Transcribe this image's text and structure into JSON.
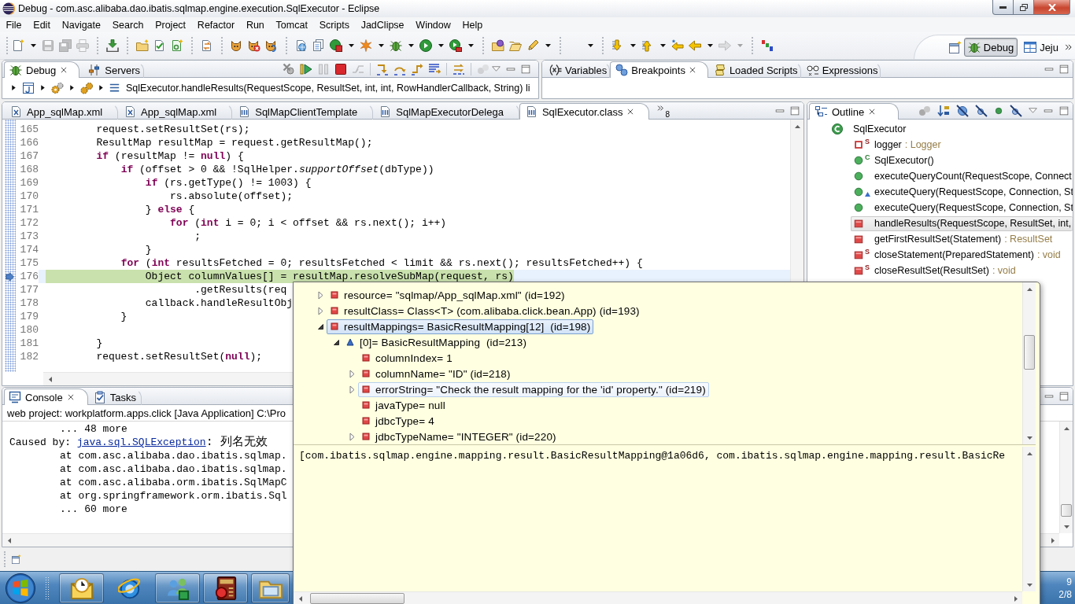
{
  "window": {
    "title": "Debug - com.asc.alibaba.dao.ibatis.sqlmap.engine.execution.SqlExecutor - Eclipse"
  },
  "menu": [
    "File",
    "Edit",
    "Navigate",
    "Search",
    "Project",
    "Refactor",
    "Run",
    "Tomcat",
    "Scripts",
    "JadClipse",
    "Window",
    "Help"
  ],
  "toolbar": [
    [
      {
        "disabled": false,
        "dropdown": true
      },
      {
        "disabled": true,
        "dropdown": false
      },
      {
        "disabled": true,
        "dropdown": false
      },
      {
        "disabled": true,
        "dropdown": false
      }
    ],
    [
      {
        "disabled": false,
        "dropdown": false
      }
    ],
    [
      {
        "disabled": false,
        "dropdown": false
      },
      {
        "disabled": false,
        "dropdown": false
      },
      {
        "disabled": false,
        "dropdown": false
      }
    ],
    [
      {
        "disabled": false,
        "dropdown": false
      }
    ],
    [
      {
        "disabled": false,
        "dropdown": false
      },
      {
        "disabled": false,
        "dropdown": false
      },
      {
        "disabled": false,
        "dropdown": false
      }
    ],
    [
      {
        "disabled": false,
        "dropdown": false
      },
      {
        "disabled": false,
        "dropdown": false
      },
      {
        "disabled": false,
        "dropdown": true
      },
      {
        "disabled": false,
        "dropdown": true
      },
      {
        "disabled": false,
        "dropdown": true
      },
      {
        "disabled": false,
        "dropdown": true
      },
      {
        "disabled": false,
        "dropdown": true
      }
    ],
    [
      {
        "disabled": false,
        "dropdown": false
      },
      {
        "disabled": false,
        "dropdown": false
      },
      {
        "disabled": false,
        "dropdown": true
      }
    ],
    [
      {
        "disabled": false,
        "dropdown": true
      }
    ],
    [
      {
        "disabled": false,
        "dropdown": true
      },
      {
        "disabled": false,
        "dropdown": true
      },
      {
        "disabled": false,
        "dropdown": false
      },
      {
        "disabled": false,
        "dropdown": true
      },
      {
        "disabled": true,
        "dropdown": true
      }
    ],
    [
      {
        "disabled": false,
        "dropdown": false
      }
    ]
  ],
  "perspectives": [
    {
      "label": "Debug",
      "selected": true
    },
    {
      "label": "Jeju",
      "selected": false
    }
  ],
  "debug_view": {
    "tabs": [
      {
        "label": "Debug",
        "selected": true
      },
      {
        "label": "Servers",
        "selected": false
      }
    ],
    "toolbar": [
      [
        {
          "disabled": false
        },
        {
          "disabled": false
        },
        {
          "disabled": true
        },
        {
          "disabled": false
        },
        {
          "disabled": true
        }
      ],
      [
        {
          "disabled": false
        },
        {
          "disabled": false
        },
        {
          "disabled": false
        },
        {
          "disabled": false
        }
      ],
      [
        {
          "disabled": false
        }
      ],
      [
        {
          "disabled": true
        }
      ]
    ],
    "breadcrumb": "SqlExecutor.handleResults(RequestScope, ResultSet, int, int, RowHandlerCallback, String) li"
  },
  "variables_view": {
    "tabs": [
      {
        "label": "Variables",
        "selected": false
      },
      {
        "label": "Breakpoints",
        "selected": true
      },
      {
        "label": "Loaded Scripts",
        "selected": false
      },
      {
        "label": "Expressions",
        "selected": false
      }
    ]
  },
  "editor": {
    "tabs": [
      {
        "label": "App_sqlMap.xml",
        "kind": "xml",
        "selected": false
      },
      {
        "label": "App_sqlMap.xml",
        "kind": "xml",
        "selected": false
      },
      {
        "label": "SqlMapClientTemplate",
        "kind": "class",
        "selected": false
      },
      {
        "label": "SqlMapExecutorDelega",
        "kind": "class",
        "selected": false
      },
      {
        "label": "SqlExecutor.class",
        "kind": "class",
        "selected": true
      }
    ],
    "overflow_count": "8",
    "lines": [
      {
        "number": "165",
        "code": "        request.setResultSet(rs);",
        "current": false
      },
      {
        "number": "166",
        "code": "        ResultMap resultMap = request.getResultMap();",
        "current": false
      },
      {
        "number": "167",
        "code": "        **if** (resultMap != **null**) {",
        "current": false
      },
      {
        "number": "168",
        "code": "            **if** (offset > 0 && !SqlHelper.*supportOffset*(dbType))",
        "current": false
      },
      {
        "number": "169",
        "code": "                **if** (rs.getType() != 1003) {",
        "current": false
      },
      {
        "number": "170",
        "code": "                    rs.absolute(offset);",
        "current": false
      },
      {
        "number": "171",
        "code": "                } **else** {",
        "current": false
      },
      {
        "number": "172",
        "code": "                    **for** (**int** i = 0; i < offset && rs.next(); i++)",
        "current": false
      },
      {
        "number": "173",
        "code": "                        ;",
        "current": false
      },
      {
        "number": "174",
        "code": "                }",
        "current": false
      },
      {
        "number": "175",
        "code": "            **for** (**int** resultsFetched = 0; resultsFetched < limit && rs.next(); resultsFetched++) {",
        "current": false
      },
      {
        "number": "176",
        "code": "                Object columnValues[] = resultMap.resolveSubMap(request, rs)",
        "current": true
      },
      {
        "number": "177",
        "code": "                        .getResults(req",
        "current": false
      },
      {
        "number": "178",
        "code": "                callback.handleResultObj",
        "current": false
      },
      {
        "number": "179",
        "code": "            }",
        "current": false
      },
      {
        "number": "180",
        "current": false
      },
      {
        "number": "181",
        "code": "        }",
        "current": false
      },
      {
        "number": "182",
        "code": "        request.setResultSet(**null**);",
        "current": false
      }
    ]
  },
  "outline": {
    "tabs": [
      {
        "label": "Outline",
        "selected": true
      }
    ],
    "tree": [
      {
        "label": "SqlExecutor",
        "kind": "class",
        "overrides": false,
        "selected": false,
        "children": [
          {
            "label": "logger",
            "decoration": ": Logger",
            "kind": "field",
            "private": true,
            "badge": "S",
            "overrides": false,
            "selected": false
          },
          {
            "label": "SqlExecutor()",
            "kind": "method",
            "private": false,
            "badge": "C",
            "overrides": false,
            "selected": false
          },
          {
            "label": "executeQueryCount(RequestScope, Connect",
            "kind": "method",
            "private": false,
            "overrides": false,
            "selected": false
          },
          {
            "label": "executeQuery(RequestScope, Connection, St",
            "kind": "method",
            "private": false,
            "overrides": true,
            "selected": false
          },
          {
            "label": "executeQuery(RequestScope, Connection, St",
            "kind": "method",
            "private": false,
            "overrides": false,
            "selected": false
          },
          {
            "label": "handleResults(RequestScope, ResultSet, int,",
            "kind": "method",
            "private": true,
            "overrides": false,
            "selected": true
          },
          {
            "label": "getFirstResultSet(Statement)",
            "decoration": ": ResultSet",
            "kind": "method",
            "private": true,
            "overrides": false,
            "selected": false
          },
          {
            "label": "closeStatement(PreparedStatement)",
            "decoration": ": void",
            "kind": "method",
            "private": true,
            "badge": "S",
            "overrides": false,
            "selected": false
          },
          {
            "label": "closeResultSet(ResultSet)",
            "decoration": ": void",
            "kind": "method",
            "private": true,
            "badge": "S",
            "overrides": false,
            "selected": false
          }
        ]
      }
    ]
  },
  "console": {
    "tabs": [
      {
        "label": "Console",
        "selected": true
      },
      {
        "label": "Tasks",
        "selected": false
      }
    ],
    "header": "web project: workplatform.apps.click [Java Application] C:\\Pro",
    "lines": [
      {
        "kind": "frame",
        "text": "... 48 more"
      },
      {
        "kind": "cause",
        "text": "Caused by: ",
        "link": "java.sql.SQLException",
        "message": ": 列名无效"
      },
      {
        "kind": "frame",
        "text": "at com.asc.alibaba.dao.ibatis.sqlmap."
      },
      {
        "kind": "frame",
        "text": "at com.asc.alibaba.dao.ibatis.sqlmap."
      },
      {
        "kind": "frame",
        "text": "at com.asc.alibaba.orm.ibatis.SqlMapC"
      },
      {
        "kind": "frame",
        "text": "at org.springframework.orm.ibatis.Sql"
      },
      {
        "kind": "frame",
        "text": "... 60 more"
      }
    ]
  },
  "taskbar": {
    "buttons": [
      {
        "running": true
      },
      {
        "running": false
      },
      {
        "running": true
      },
      {
        "running": true
      },
      {
        "running": true
      }
    ],
    "clock_time": "9",
    "clock_date": "2/8"
  },
  "inspect_popup": {
    "tree": [
      {
        "label": "resource= \"sqlmap/App_sqlMap.xml\" (id=192)",
        "kind": "field",
        "has_children": true,
        "expanded": false,
        "selected": false,
        "hovered": false
      },
      {
        "label": "resultClass= Class<T> (com.alibaba.click.bean.App) (id=193)",
        "kind": "field",
        "has_children": true,
        "expanded": false,
        "selected": false,
        "hovered": false
      },
      {
        "label": "resultMappings= BasicResultMapping[12]  (id=198)",
        "kind": "field",
        "has_children": true,
        "expanded": true,
        "selected": true,
        "hovered": false,
        "children": [
          {
            "label": "[0]= BasicResultMapping  (id=213)",
            "kind": "element",
            "has_children": true,
            "expanded": true,
            "selected": false,
            "hovered": false,
            "children": [
              {
                "label": "columnIndex= 1",
                "kind": "field",
                "has_children": false,
                "expanded": false,
                "selected": false,
                "hovered": false
              },
              {
                "label": "columnName= \"ID\" (id=218)",
                "kind": "field",
                "has_children": true,
                "expanded": false,
                "selected": false,
                "hovered": false
              },
              {
                "label": "errorString= \"Check the result mapping for the 'id' property.\" (id=219)",
                "kind": "field",
                "has_children": true,
                "expanded": false,
                "selected": false,
                "hovered": true
              },
              {
                "label": "javaType= null",
                "kind": "field",
                "has_children": false,
                "expanded": false,
                "selected": false,
                "hovered": false
              },
              {
                "label": "jdbcType= 4",
                "kind": "field",
                "has_children": false,
                "expanded": false,
                "selected": false,
                "hovered": false
              },
              {
                "label": "jdbcTypeName= \"INTEGER\" (id=220)",
                "kind": "field",
                "has_children": true,
                "expanded": false,
                "selected": false,
                "hovered": false
              }
            ]
          }
        ]
      }
    ],
    "detail": "[com.ibatis.sqlmap.engine.mapping.result.BasicResultMapping@1a06d6, com.ibatis.sqlmap.engine.mapping.result.BasicRe"
  }
}
